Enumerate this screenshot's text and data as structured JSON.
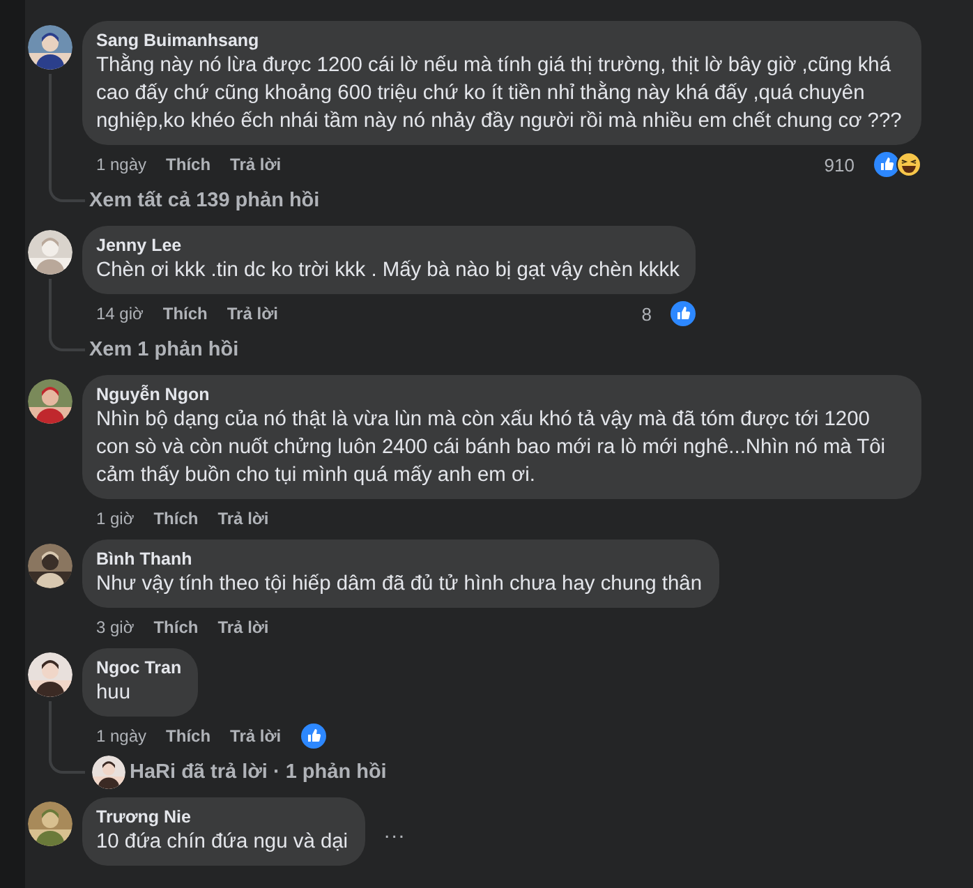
{
  "comments": [
    {
      "author": "Sang Buimanhsang",
      "text": "Thằng này nó lừa được 1200 cái lờ nếu mà tính giá thị trường, thịt lờ bây giờ ,cũng khá cao đấy chứ cũng khoảng 600 triệu chứ ko ít tiền nhỉ thằng này khá đấy ,quá chuyên nghiệp,ko khéo ếch nhái tầm này nó nhảy đầy người rồi mà nhiều em chết chung cơ ???",
      "time": "1 ngày",
      "actions": [
        "Thích",
        "Trả lời"
      ],
      "reaction_count": "910",
      "reactions": [
        {
          "kind": "like"
        },
        {
          "kind": "haha"
        }
      ],
      "replies": {
        "kind": "link",
        "text": "Xem tất cả 139 phản hồi"
      }
    },
    {
      "author": "Jenny Lee",
      "text": "Chèn ơi kkk .tin dc ko trời kkk . Mấy bà nào bị gạt vậy chèn kkkk",
      "time": "14 giờ",
      "actions": [
        "Thích",
        "Trả lời"
      ],
      "reaction_count": "8",
      "reactions": [
        {
          "kind": "like"
        }
      ],
      "replies": {
        "kind": "link",
        "text": "Xem 1 phản hồi"
      }
    },
    {
      "author": "Nguyễn Ngon",
      "text": "Nhìn bộ dạng của nó thật là vừa lùn mà còn xấu khó tả vậy mà đã tóm được tới 1200 con sò và còn nuốt chửng luôn 2400 cái bánh bao mới ra lò mới nghê...Nhìn nó mà Tôi cảm thấy buồn cho tụi mình quá mấy anh em ơi.",
      "time": "1 giờ",
      "actions": [
        "Thích",
        "Trả lời"
      ]
    },
    {
      "author": "Bình Thanh",
      "text": "Như vậy tính theo tội hiếp dâm đã đủ tử hình chưa hay chung thân",
      "time": "3 giờ",
      "actions": [
        "Thích",
        "Trả lời"
      ]
    },
    {
      "author": "Ngoc Tran",
      "text": "huu",
      "time": "1 ngày",
      "actions": [
        "Thích",
        "Trả lời"
      ],
      "reactions": [
        {
          "kind": "like"
        }
      ],
      "replies": {
        "kind": "replied",
        "text": "HaRi đã trả lời · 1 phản hồi"
      }
    },
    {
      "author": "Trương Nie",
      "text": "10 đứa chín đứa ngu và dại",
      "more": "..."
    }
  ]
}
